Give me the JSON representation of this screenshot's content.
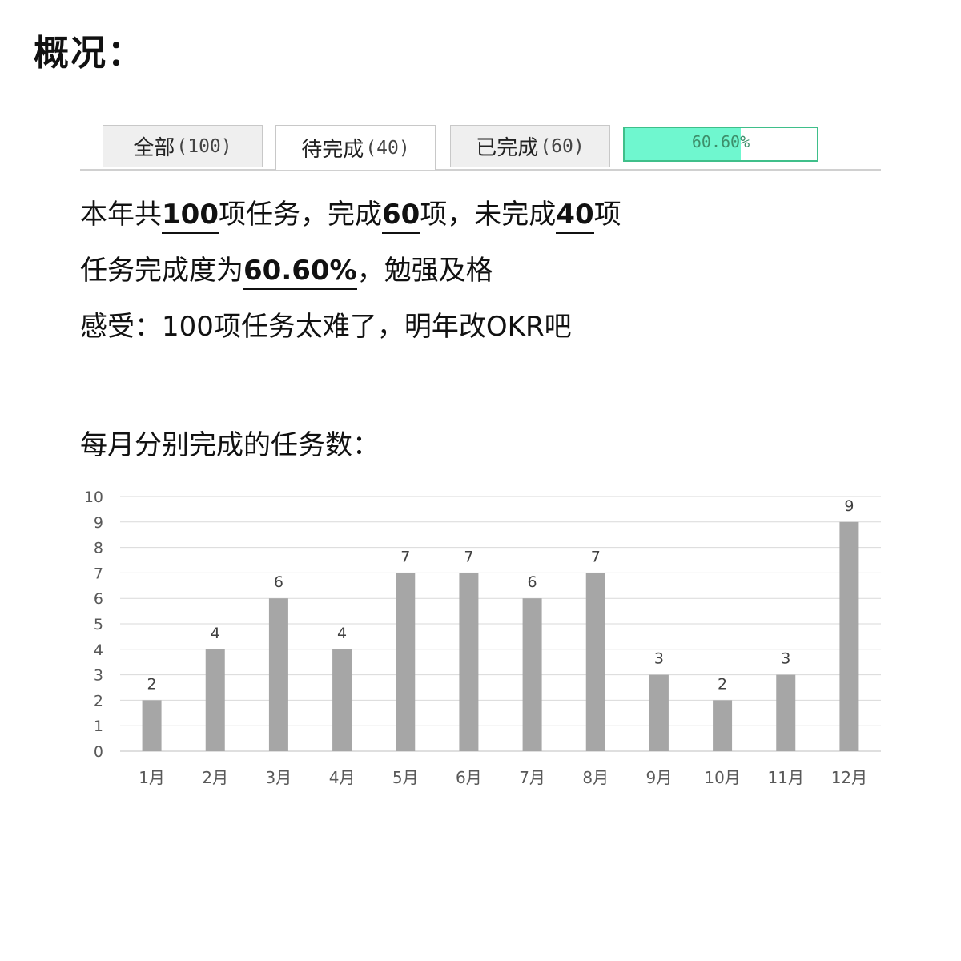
{
  "header": {
    "title": "概况："
  },
  "tabs": [
    {
      "label": "全部",
      "count": "(100)"
    },
    {
      "label": "待完成",
      "count": "(40)"
    },
    {
      "label": "已完成",
      "count": "(60)"
    }
  ],
  "progress": {
    "text": "60.60%",
    "fraction": 0.606,
    "fill_color": "#6ff7cf",
    "border_color": "#3fbf8a"
  },
  "summary": {
    "line1": {
      "p1": "本年共",
      "total": "100",
      "p2": "项任务，完成",
      "done": "60",
      "p3": "项，未完成",
      "pending": "40",
      "p4": "项"
    },
    "line2": {
      "p1": "任务完成度为",
      "rate": "60.60%",
      "p2": "，勉强及格"
    },
    "line3": "感受：100项任务太难了，明年改OKR吧"
  },
  "chart_title": "每月分别完成的任务数：",
  "chart_data": {
    "type": "bar",
    "categories": [
      "1月",
      "2月",
      "3月",
      "4月",
      "5月",
      "6月",
      "7月",
      "8月",
      "9月",
      "10月",
      "11月",
      "12月"
    ],
    "values": [
      2,
      4,
      6,
      4,
      7,
      7,
      6,
      7,
      3,
      2,
      3,
      9
    ],
    "ylim": [
      0,
      10
    ],
    "yticks": [
      0,
      1,
      2,
      3,
      4,
      5,
      6,
      7,
      8,
      9,
      10
    ],
    "grid": true,
    "bar_color": "#a6a6a6",
    "title": "",
    "xlabel": "",
    "ylabel": ""
  }
}
